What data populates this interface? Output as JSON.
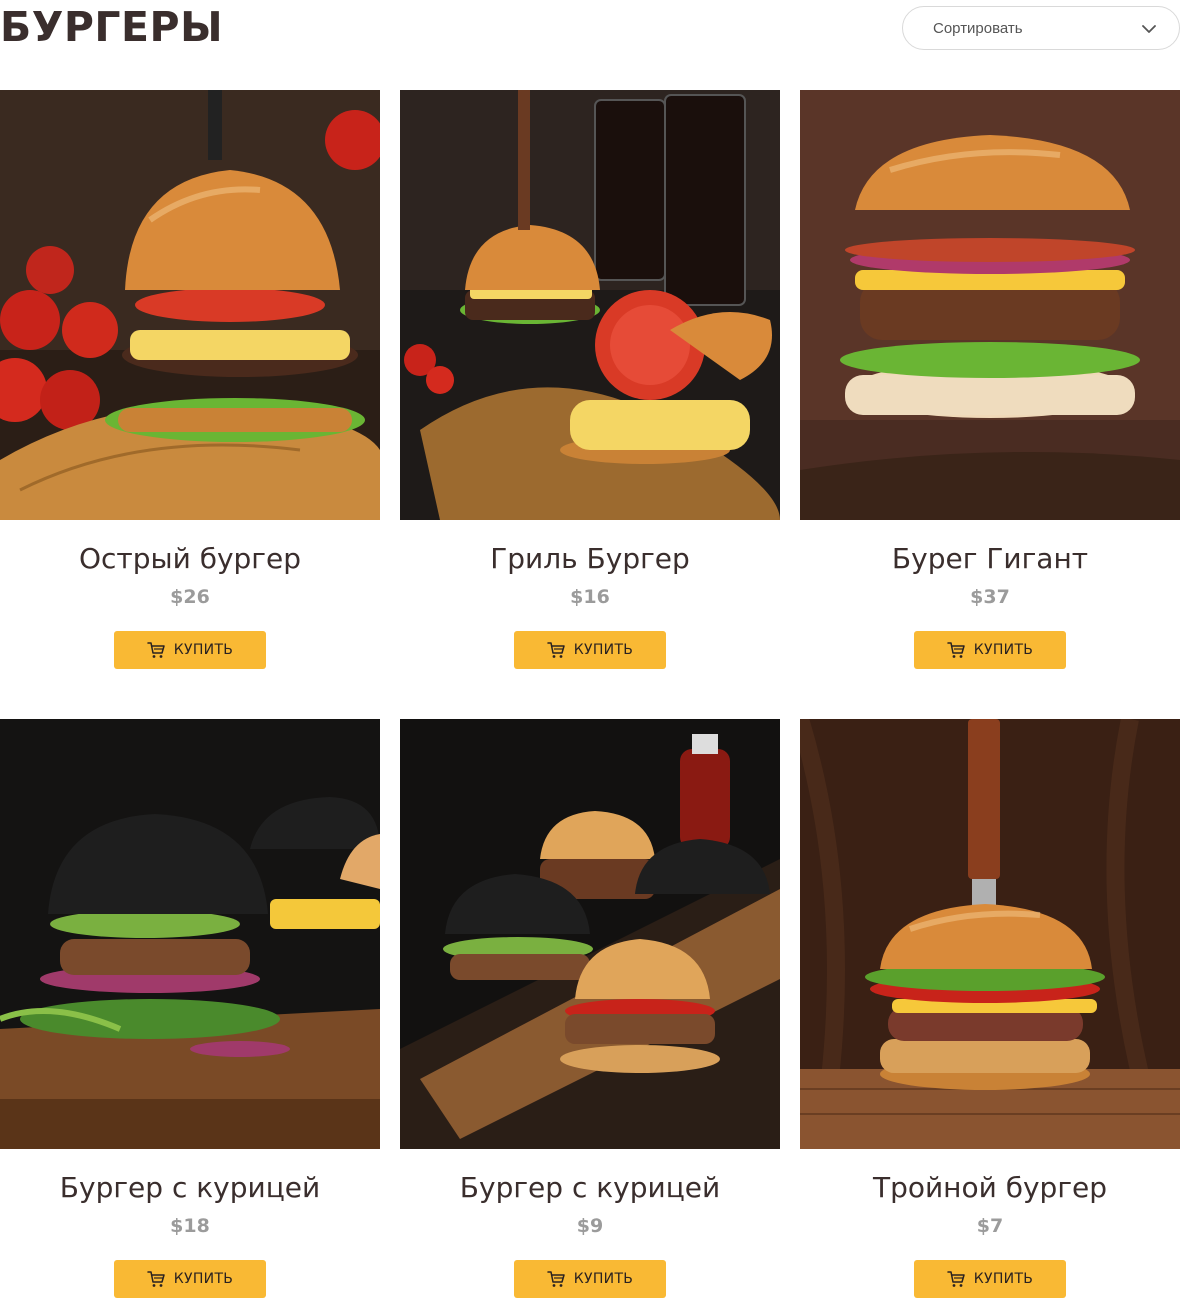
{
  "header": {
    "title": "БУРГЕРЫ",
    "sort": {
      "label": "Сортировать",
      "icon": "chevron-down-icon"
    }
  },
  "products": [
    {
      "title": "Острый бургер",
      "price": "$26",
      "buy_label": "КУПИТЬ",
      "image": "burger-photo-tomatoes-board",
      "bun": "sesame"
    },
    {
      "title": "Гриль Бургер",
      "price": "$16",
      "buy_label": "КУПИТЬ",
      "image": "burger-photo-cola-glasses",
      "bun": "sesame"
    },
    {
      "title": "Бурег Гигант",
      "price": "$37",
      "buy_label": "КУПИТЬ",
      "image": "burger-photo-bacon",
      "bun": "plain"
    },
    {
      "title": "Бургер с курицей",
      "price": "$18",
      "buy_label": "КУПИТЬ",
      "image": "burger-photo-black-bun",
      "bun": "black"
    },
    {
      "title": "Бургер с курицей",
      "price": "$9",
      "buy_label": "КУПИТЬ",
      "image": "burger-photo-assorted-buns",
      "bun": "mixed"
    },
    {
      "title": "Тройной бургер",
      "price": "$7",
      "buy_label": "КУПИТЬ",
      "image": "burger-photo-knife-wood",
      "bun": "sesame"
    }
  ],
  "icons": {
    "cart": "shopping-cart-icon",
    "chevron": "chevron-down-icon"
  },
  "colors": {
    "accent": "#f9b934",
    "title_text": "#3a2e2d",
    "price_text": "#9b9b9b"
  }
}
